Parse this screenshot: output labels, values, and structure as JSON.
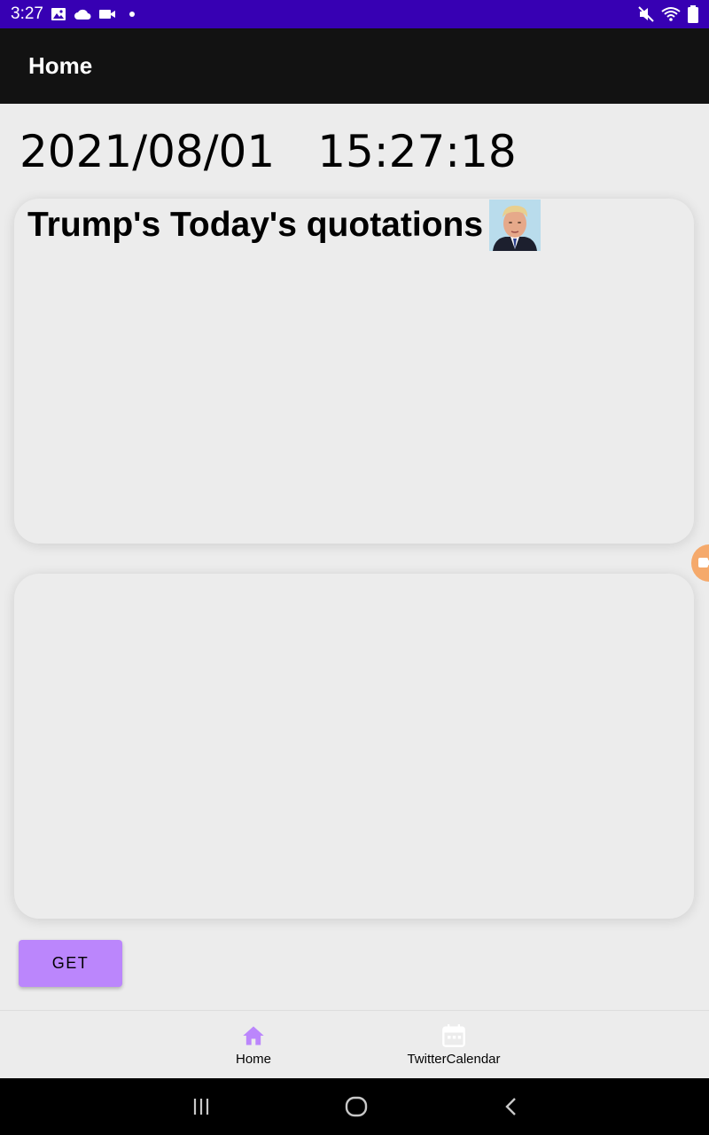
{
  "status_bar": {
    "time": "3:27",
    "icons_left": [
      "image-icon",
      "cloud-icon",
      "video-icon",
      "dot-icon"
    ],
    "icons_right": [
      "mute-icon",
      "wifi-icon",
      "battery-icon"
    ]
  },
  "app_bar": {
    "title": "Home"
  },
  "content": {
    "date": "2021/08/01",
    "time": "15:27:18",
    "quote_card": {
      "title": "Trump's Today's quotations",
      "portrait": "trump-portrait-image"
    },
    "get_button_label": "GET"
  },
  "bottom_nav": {
    "items": [
      {
        "label": "Home",
        "icon": "home-icon",
        "active": true
      },
      {
        "label": "TwitterCalendar",
        "icon": "calendar-icon",
        "active": false
      }
    ]
  },
  "system_nav": [
    "recents-icon",
    "home-circle-icon",
    "back-icon"
  ],
  "colors": {
    "status_bar": "#3700b3",
    "app_bar": "#121212",
    "accent": "#bb86fc",
    "background": "#ececec"
  }
}
